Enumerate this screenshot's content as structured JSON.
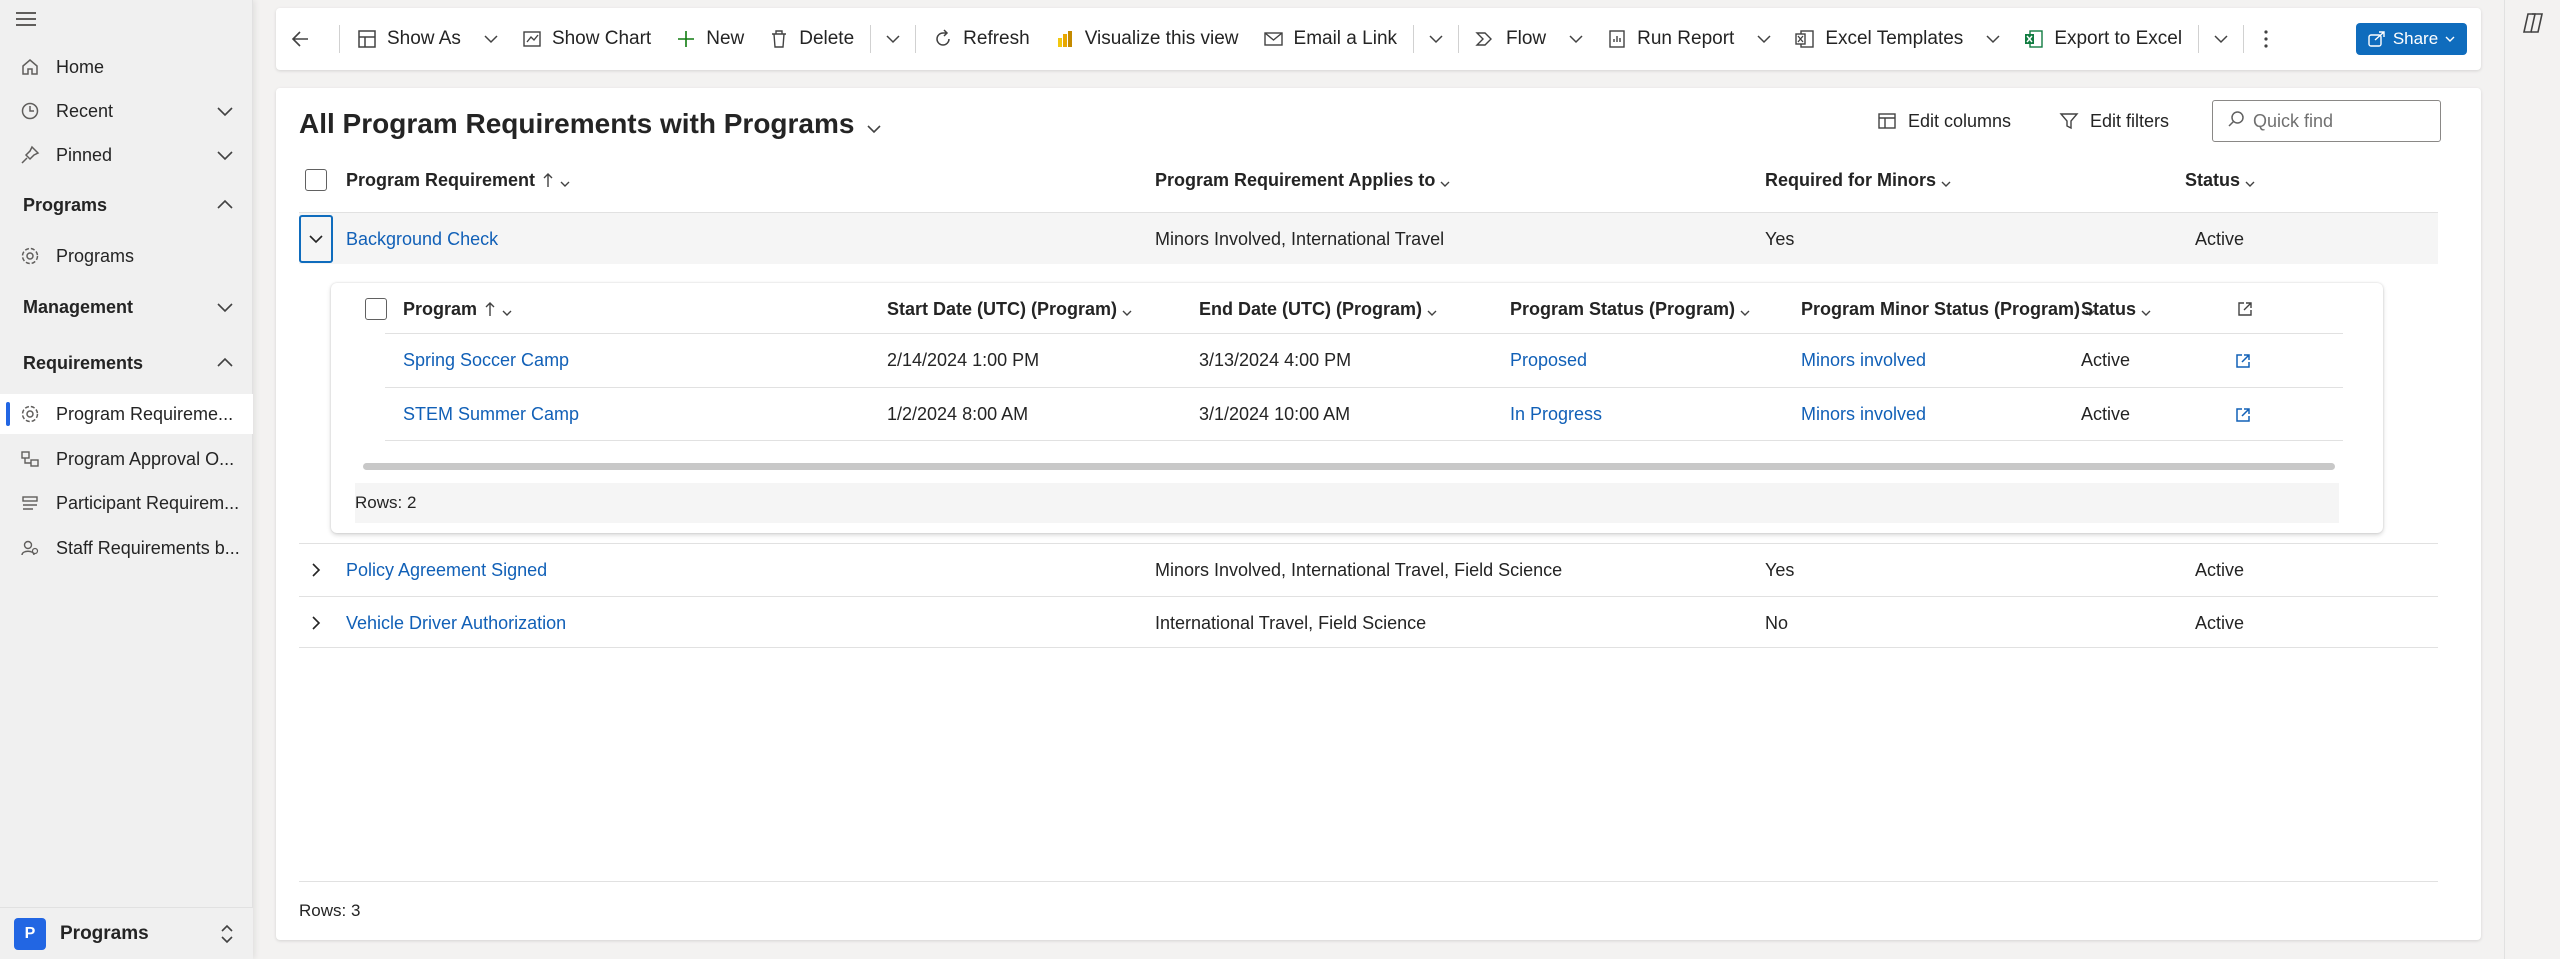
{
  "sidebar": {
    "home": "Home",
    "recent": "Recent",
    "pinned": "Pinned",
    "groups": [
      {
        "label": "Programs",
        "items": [
          {
            "label": "Programs",
            "icon": "gear-icon"
          }
        ]
      },
      {
        "label": "Management",
        "items": []
      },
      {
        "label": "Requirements",
        "items": [
          {
            "label": "Program Requireme...",
            "icon": "gear-icon"
          },
          {
            "label": "Program Approval O...",
            "icon": "org-icon"
          },
          {
            "label": "Participant Requirem...",
            "icon": "people-icon"
          },
          {
            "label": "Staff Requirements b...",
            "icon": "person-icon"
          }
        ]
      }
    ],
    "area": {
      "badge": "P",
      "label": "Programs"
    }
  },
  "toolbar": {
    "show_as": "Show As",
    "show_chart": "Show Chart",
    "new": "New",
    "delete": "Delete",
    "refresh": "Refresh",
    "visualize": "Visualize this view",
    "email_link": "Email a Link",
    "flow": "Flow",
    "run_report": "Run Report",
    "excel_templates": "Excel Templates",
    "export_excel": "Export to Excel",
    "share": "Share"
  },
  "view": {
    "title": "All Program Requirements with Programs",
    "edit_columns": "Edit columns",
    "edit_filters": "Edit filters",
    "quick_find_placeholder": "Quick find"
  },
  "grid": {
    "columns": [
      "Program Requirement",
      "Program Requirement Applies to",
      "Required for Minors",
      "Status"
    ],
    "rows": [
      {
        "name": "Background Check",
        "applies": "Minors Involved, International Travel",
        "minors": "Yes",
        "status": "Active"
      },
      {
        "name": "Policy Agreement Signed",
        "applies": "Minors Involved, International Travel, Field Science",
        "minors": "Yes",
        "status": "Active"
      },
      {
        "name": "Vehicle Driver Authorization",
        "applies": "International Travel, Field Science",
        "minors": "No",
        "status": "Active"
      }
    ],
    "footer": "Rows: 3"
  },
  "subgrid": {
    "columns": [
      "Program",
      "Start Date (UTC) (Program)",
      "End Date (UTC) (Program)",
      "Program Status (Program)",
      "Program Minor Status (Program)",
      "Status"
    ],
    "rows": [
      {
        "program": "Spring Soccer Camp",
        "start": "2/14/2024 1:00 PM",
        "end": "3/13/2024 4:00 PM",
        "pstatus": "Proposed",
        "minor": "Minors involved",
        "status": "Active"
      },
      {
        "program": "STEM Summer Camp",
        "start": "1/2/2024 8:00 AM",
        "end": "3/1/2024 10:00 AM",
        "pstatus": "In Progress",
        "minor": "Minors involved",
        "status": "Active"
      }
    ],
    "footer": "Rows: 2"
  },
  "colors": {
    "link": "#1160b7",
    "accent": "#0f6cbd"
  }
}
